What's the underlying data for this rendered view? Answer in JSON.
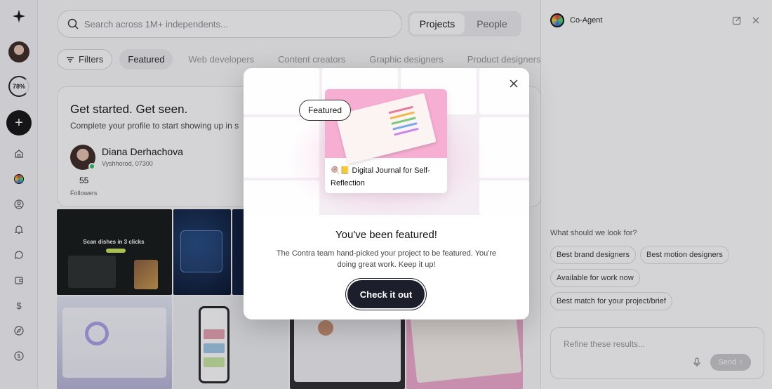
{
  "rail": {
    "progress": "78%",
    "progress_fraction": 0.78,
    "icons": [
      "home-icon",
      "co-agent-icon",
      "profile-icon",
      "notifications-icon",
      "messages-icon",
      "wallet-icon",
      "dollar-icon",
      "explore-icon",
      "currency-icon"
    ]
  },
  "search": {
    "placeholder": "Search across 1M+ independents..."
  },
  "toggle": {
    "projects": "Projects",
    "people": "People",
    "active": "Projects"
  },
  "filters": {
    "filter_label": "Filters",
    "chips": [
      "Featured",
      "Web developers",
      "Content creators",
      "Graphic designers",
      "Product designers"
    ]
  },
  "profile_card": {
    "title": "Get started. Get seen.",
    "subtitle": "Complete your profile to start showing up in s",
    "name": "Diana Derhachova",
    "location": "Vyshhorod, 07300",
    "followers_count": "55",
    "followers_label": "Followers"
  },
  "gallery": {
    "tile1_headline": "Scan dishes in 3 clicks"
  },
  "agent": {
    "title": "Co-Agent",
    "question": "What should we look for?",
    "suggestions": [
      "Best brand designers",
      "Best motion designers",
      "Available for work now",
      "Best match for your project/brief"
    ],
    "input_placeholder": "Refine these results...",
    "send_label": "Send"
  },
  "modal": {
    "badge": "Featured",
    "project_title": "🍭📒 Digital Journal for Self-Reflection",
    "heading": "You've been featured!",
    "body": "The Contra team hand-picked your project to be featured. You're doing great work. Keep it up!",
    "cta": "Check it out"
  },
  "colors": {
    "cta_bg": "#1c1e2c",
    "accent_green": "#2dbf5e",
    "project_pink": "#f6aed2"
  }
}
